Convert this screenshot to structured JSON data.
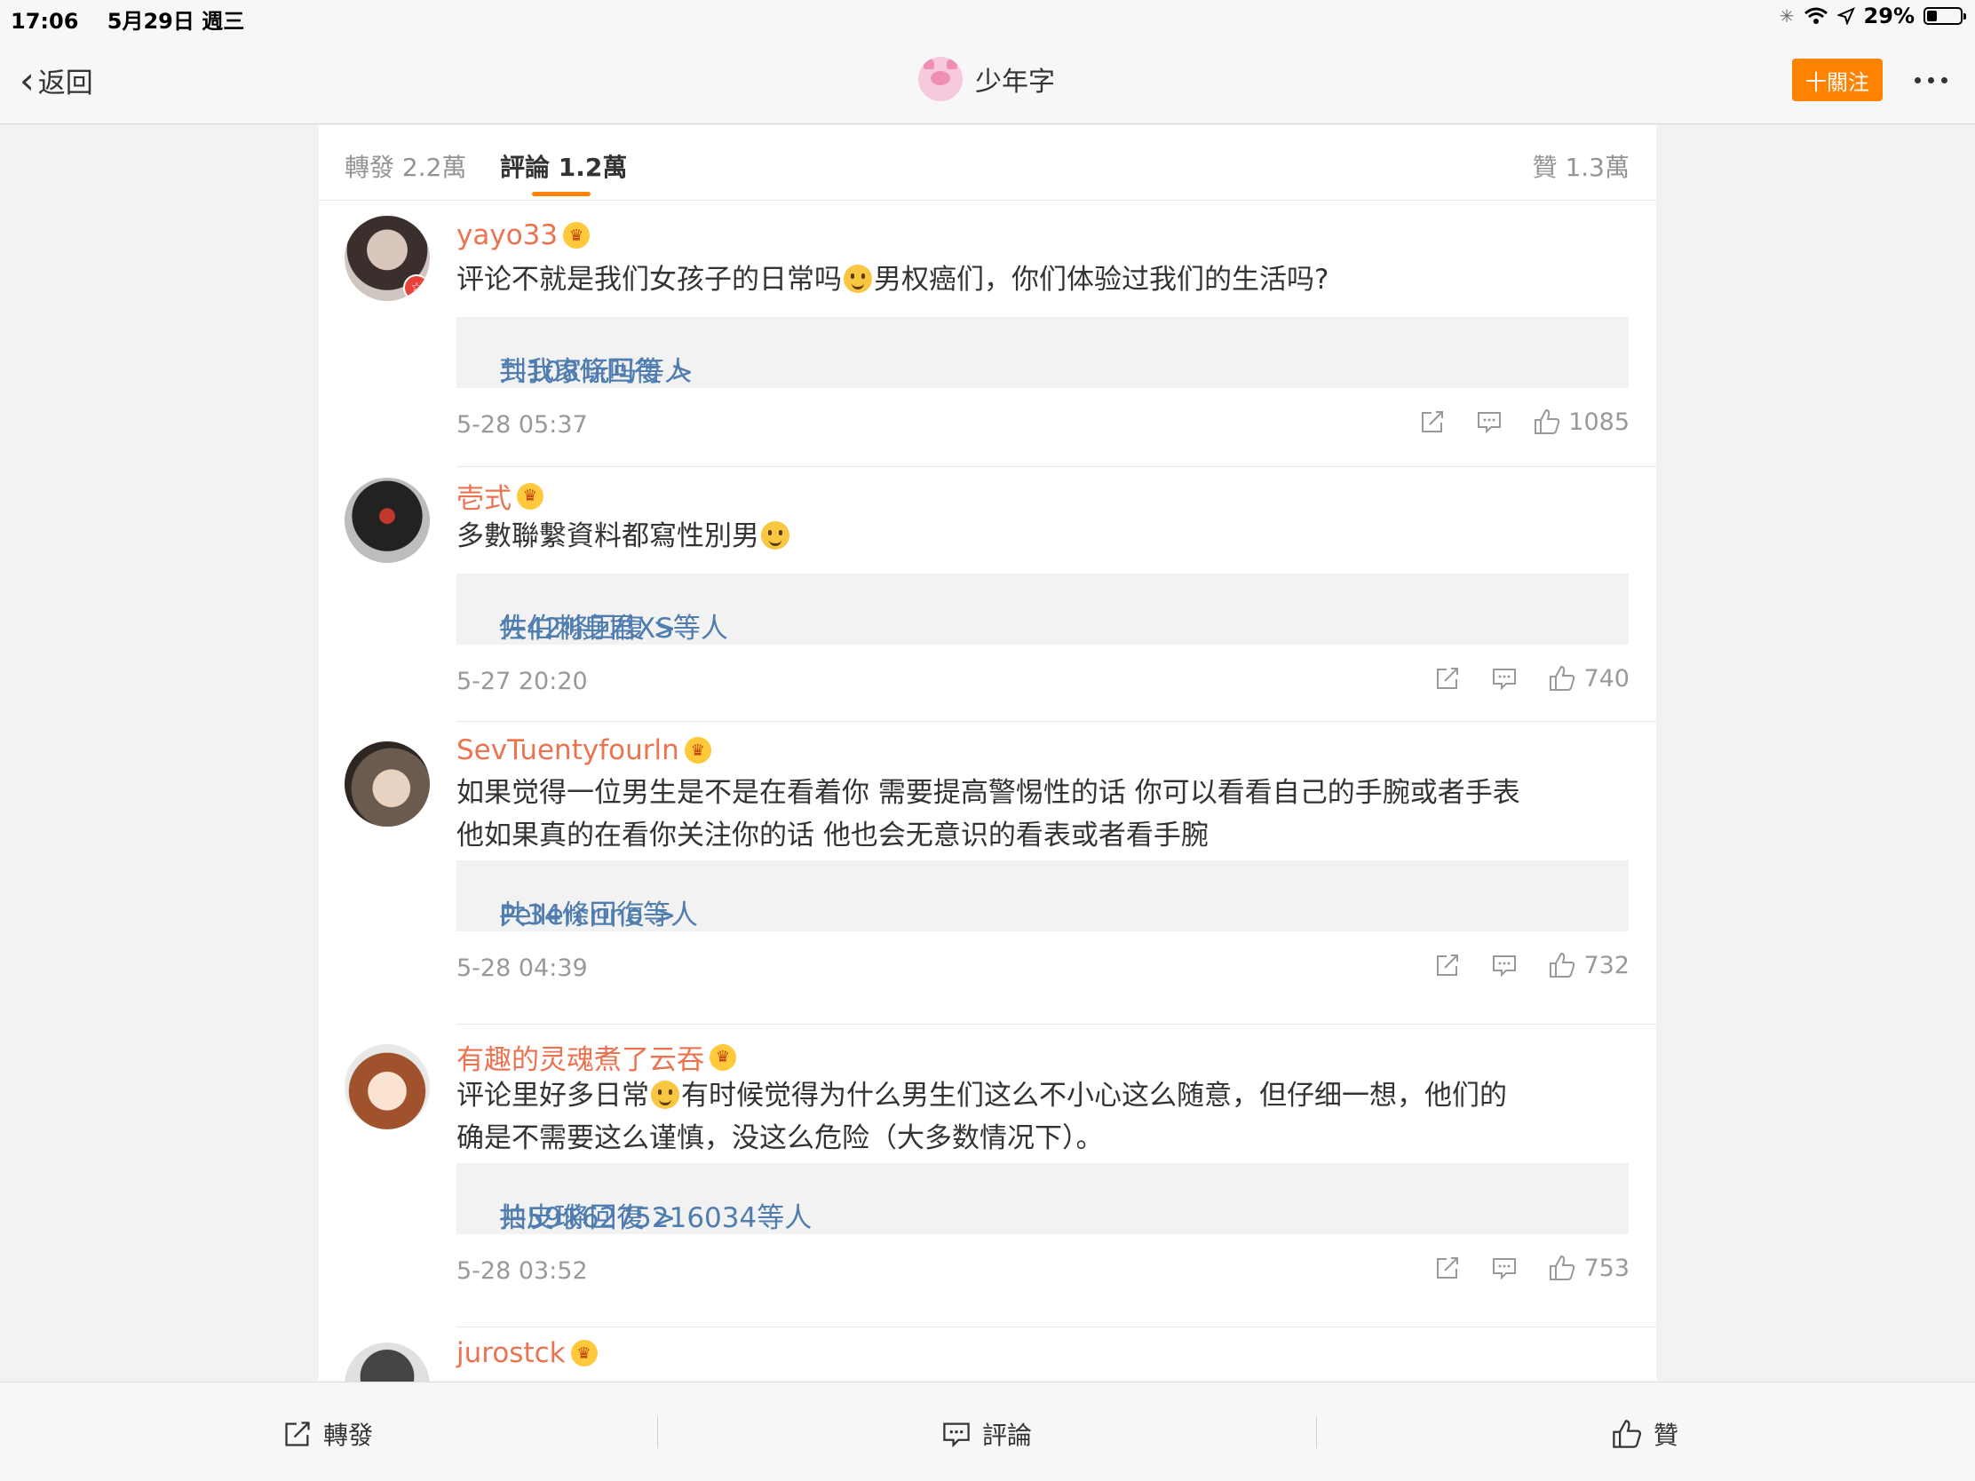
{
  "status_bar": {
    "time": "17:06",
    "date": "5月29日 週三",
    "battery": "29%",
    "battery_level": 0.29
  },
  "nav": {
    "back_label": "返回",
    "title": "少年字",
    "follow_label": "十關注"
  },
  "tabs": {
    "repost": "轉發 2.2萬",
    "comments": "評論 1.2萬",
    "likes": "贊 1.3萬"
  },
  "comments": [
    {
      "username": "yayo33",
      "text_before": "评论不就是我们女孩子的日常吗",
      "text_after": "男权癌们，你们体验过我们的生活吗?",
      "reply_prefix": "到我家玩吗等人 ",
      "reply_count": "共108條回復 >",
      "time": "5-28 05:37",
      "likes": "1085"
    },
    {
      "username": "壱式",
      "text_before": "多數聯繫資料都寫性別男",
      "text_after": "",
      "reply_prefix": "佐伯刺身君XS等人 ",
      "reply_count": "共42條回復 >",
      "time": "5-27 20:20",
      "likes": "740"
    },
    {
      "username": "SevTuentyfourln",
      "text_line1": "如果觉得一位男生是不是在看着你 需要提高警惕性的话 你可以看看自己的手腕或者手表",
      "text_line2": "他如果真的在看你关注你的话 他也会无意识的看表或者看手腕",
      "reply_prefix": "Pellercrino等人 ",
      "reply_count": "共34條回復 >",
      "time": "5-28 04:39",
      "likes": "732"
    },
    {
      "username": "有趣的灵魂煮了云吞",
      "text_before": "评论里好多日常",
      "text_after": "有时候觉得为什么男生们这么不小心这么随意，但仔细一想，他们的",
      "text_line2": "确是不需要这么谨慎，没这么危险（大多数情况下）。",
      "reply_prefix": "拍皮球6275216034等人 ",
      "reply_count": "共59條回復 >",
      "time": "5-28 03:52",
      "likes": "753"
    },
    {
      "username": "jurostck"
    }
  ],
  "bottom_bar": {
    "repost": "轉發",
    "comment": "評論",
    "like": "贊"
  },
  "colors": {
    "accent": "#ff8200",
    "username": "#eb7350",
    "link": "#507daf"
  }
}
